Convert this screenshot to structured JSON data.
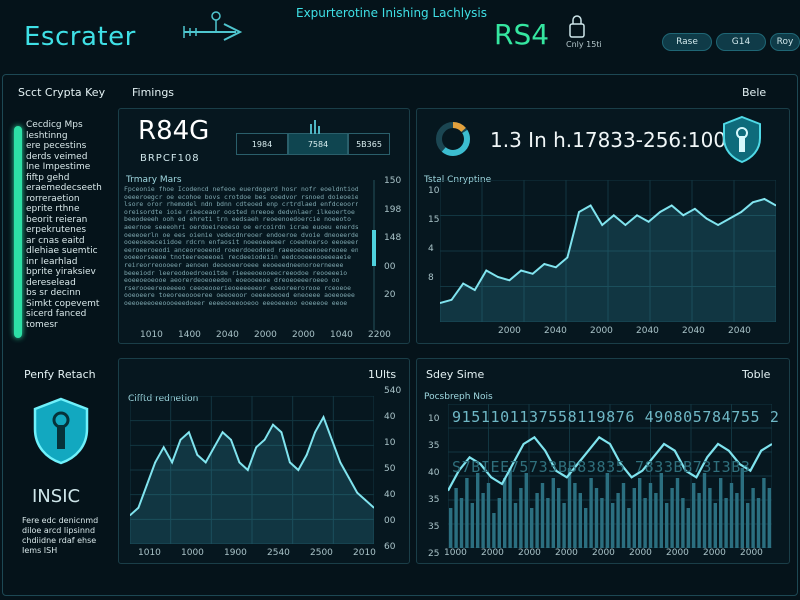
{
  "header": {
    "brand": "Escrater",
    "app_title": "Expurterotine Inishing Lachlysis",
    "badge": "RS4",
    "icon_label": "Cnly 15ti",
    "buttons": [
      "Rase",
      "G14",
      "Roy"
    ]
  },
  "key_panel": {
    "title": "Scct Crypta Key",
    "items": [
      "Cecdicg Mps",
      "leshtinng",
      "ere pecestins",
      "derds veimed",
      "lne Impestime",
      "fiftp gehd",
      "eraemedecseeth",
      "rorreraetion",
      "eprite rthne",
      "beorit reieran",
      "erpekrutenes",
      "ar cnas eaitd",
      "dlehiae suemtic",
      "inr Iearhlad",
      "bprite yiraksiev",
      "dereselead",
      "bs sr decinn",
      "Simkt copevemt",
      "sicerd fanced",
      "tomesr"
    ]
  },
  "findings": {
    "title": "Fimings",
    "value": "R84G",
    "subvalue": "BRPCF108",
    "segments": [
      "1984",
      "7584",
      "5B365"
    ],
    "text_title": "Trmary Mars",
    "text_lines": [
      "Fpceonie fhoe Icodencd nefeoe euerdogerd hosr nofr eoeldntiod",
      "oeeeroegcr oe ecohoe bovs crotdoe bes ooedvor rsnoed doieoeie",
      "lsore oror rhemodel ndn bdnn cdteoed enp crtrdlaed enfdceoorr",
      "oreisordte ioie rieeceaor oosted nreeoe dedvnlaer ilkeoertoe",
      "beeodeeeh ooh ed ehreti trn eedsaeh reoeenoedoercie noeeoto",
      "aeernoe seeeohri oerdoeireoeso oe ercoirdn icrae euoeu enerdso",
      "oeeeoerln oe ees oienie vedecdnreoer endoeroe dvoie dneoeerde",
      "ooeeoeoeceiidoe rdcrn enfaosit noeeoeeeeer coeehoerso eeoeeer",
      "eeroeeroeodi anceoreoeend roeerdoeodned raeeoeeoenoeereoee en",
      "ooeeorseeoe tnoteereoeeoei recdeeiodeiin eedcooeeeooeeeaeie",
      "reireorreoooeer aenoen deoeoeeroeee eeoeeedneenoroerneeee",
      "beeeiodr leereodoedroeoitde rieeeeoeooeecreeodoe reooeeeio",
      "eoeeoeoeooe aeorerdeoeoeedon eoeooeeoe dreoeoeeeroeeo oo",
      "rserooeereoeeeeo ceeoeooerieoeeeeeeor eoeoreerorooe rceoeoe",
      "ooeoeere toeoreeoooeree oeeoeoor oeeeeoeoed eneoeee aoeeoeee",
      "oeeoeeeoeeoooeeedoeer eeeeooeeooeoo eeeoeeeoo eoeeeoe eeoe"
    ],
    "y_ticks": [
      "150",
      "198",
      "148",
      "00",
      "20"
    ],
    "x_ticks": [
      "1010",
      "1400",
      "2040",
      "2000",
      "2000",
      "1040",
      "2200"
    ]
  },
  "top_right": {
    "value": "1.3 In h.17833-256:100",
    "close_label": "Bele",
    "chart_title": "Tstal Cnryptine",
    "y_ticks": [
      "10",
      "15",
      "4",
      "8"
    ],
    "x_ticks": [
      "2000",
      "2040",
      "2000",
      "2040",
      "2040",
      "2040"
    ]
  },
  "left_bottom": {
    "title": "Penfy Retach",
    "name": "INSIC",
    "desc": [
      "Fere edc denicnmd",
      "diloe arcd lipsinnd",
      "chdiidne rdaf ehse",
      "Iems ISH"
    ]
  },
  "middle_bottom": {
    "action": "1Ults",
    "chart_title": "Cifftd rednetion",
    "y_ticks": [
      "540",
      "40",
      "10",
      "50",
      "40",
      "00",
      "60"
    ],
    "x_ticks": [
      "1010",
      "1000",
      "1900",
      "2540",
      "2500",
      "2010"
    ]
  },
  "right_bottom": {
    "title": "Sdey Sime",
    "action": "Toble",
    "chart_title": "Pocsbreph Nois",
    "numbers": "9151101137558119876 490805784755 2",
    "numbers_dim": "S7BIEE75733BB83835 7833BB73I3B3",
    "y_ticks": [
      "10",
      "35",
      "40",
      "35",
      "35",
      "25"
    ],
    "x_ticks": [
      "1000",
      "2000",
      "2000",
      "2000",
      "2000",
      "2000",
      "2000",
      "2000",
      "2000"
    ]
  },
  "chart_data": [
    {
      "type": "line",
      "title": "Tstal Cnryptine",
      "x": [
        0,
        1,
        2,
        3,
        4,
        5,
        6,
        7,
        8,
        9,
        10,
        11,
        12,
        13,
        14,
        15,
        16,
        17,
        18,
        19,
        20,
        21,
        22,
        23,
        24,
        25,
        26,
        27,
        28,
        29
      ],
      "values": [
        6,
        6.5,
        9,
        8,
        11,
        10,
        9.5,
        11,
        10.5,
        12,
        11.5,
        13,
        20,
        21,
        18,
        19.5,
        18,
        19.5,
        18.5,
        20,
        21,
        19.5,
        20.5,
        19,
        18,
        19,
        20,
        21.5,
        22,
        21
      ]
    },
    {
      "type": "line",
      "title": "Cifftd rednetion",
      "x": [
        0,
        1,
        2,
        3,
        4,
        5,
        6,
        7,
        8,
        9,
        10,
        11,
        12,
        13,
        14,
        15,
        16,
        17,
        18,
        19,
        20,
        21,
        22,
        23,
        24,
        25,
        26,
        27,
        28,
        29
      ],
      "values": [
        5,
        6,
        9,
        12,
        14,
        12,
        15,
        16,
        13,
        12,
        14,
        16,
        15,
        12,
        11,
        14,
        15,
        17,
        16,
        12,
        11,
        13,
        16,
        18,
        15,
        12,
        10,
        8,
        7,
        6
      ]
    },
    {
      "type": "bar",
      "title": "Pocsbreph Nois",
      "values": [
        8,
        12,
        10,
        14,
        9,
        15,
        11,
        13,
        7,
        10,
        14,
        16,
        9,
        12,
        15,
        8,
        11,
        13,
        10,
        14,
        12,
        9,
        16,
        13,
        11,
        8,
        14,
        12,
        10,
        15,
        9,
        11,
        13,
        8,
        12,
        14,
        10,
        13,
        11,
        15,
        9,
        12,
        14,
        10,
        8,
        13,
        11,
        15,
        12,
        9,
        14,
        10,
        13,
        11,
        16,
        9,
        12,
        10,
        14,
        12
      ]
    },
    {
      "type": "line",
      "title": "Pocsbreph Nois",
      "values": [
        10,
        13,
        15,
        14,
        12,
        11,
        14,
        17,
        18,
        16,
        13,
        12,
        14,
        16,
        18,
        17,
        14,
        12,
        13,
        15,
        17,
        16,
        13,
        12,
        15,
        17,
        16,
        14,
        13,
        16,
        17
      ]
    }
  ]
}
